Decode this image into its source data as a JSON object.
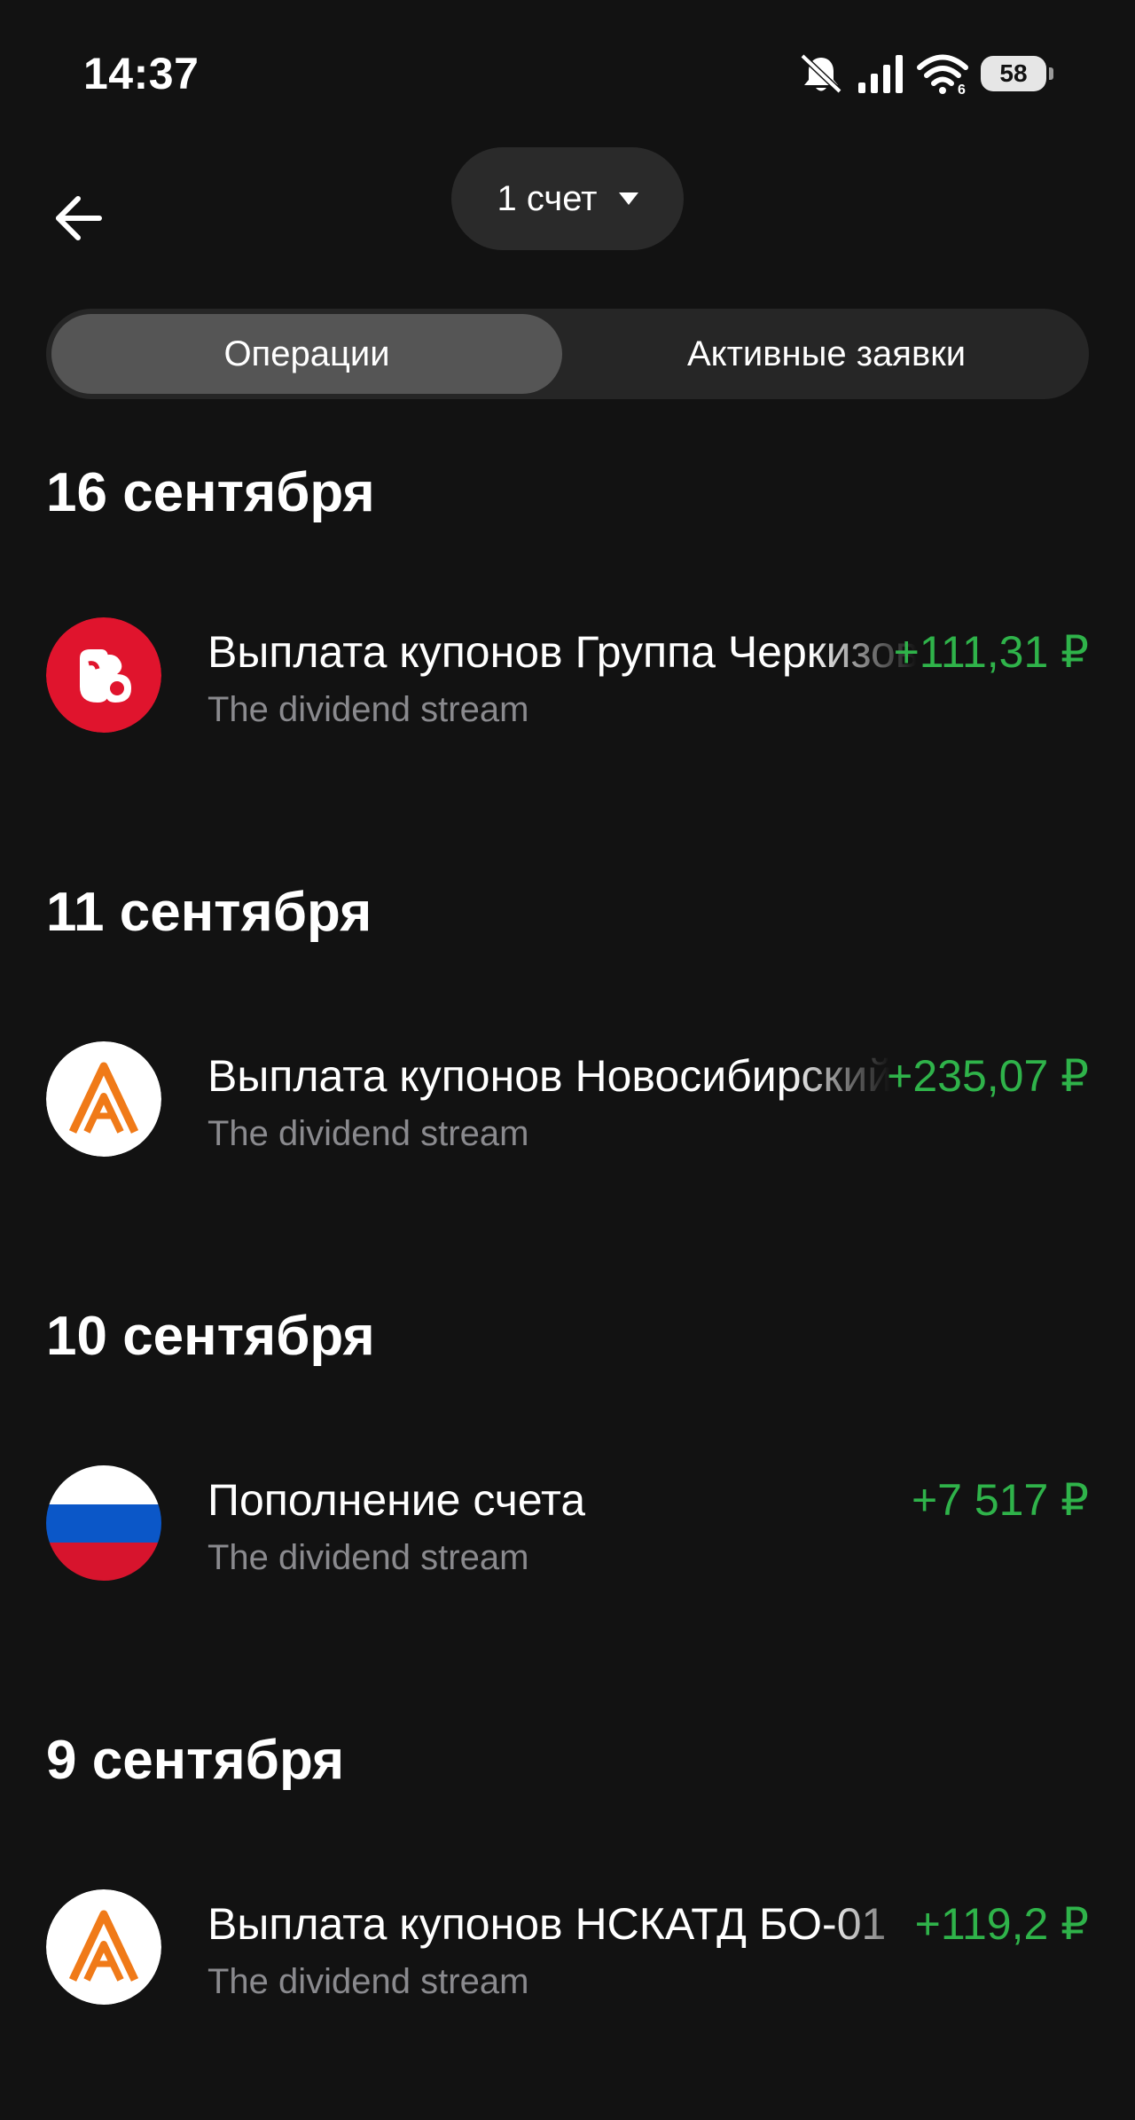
{
  "status_bar": {
    "time": "14:37",
    "battery": "58",
    "icons": [
      "mute-icon",
      "signal-icon",
      "wifi-icon",
      "battery-icon"
    ]
  },
  "header": {
    "back_icon": "arrow-left-icon",
    "account_selector": "1 счет"
  },
  "tabs": {
    "active": "Операции",
    "inactive": "Активные заявки"
  },
  "colors": {
    "background": "#121212",
    "positive_amount": "#2fb34a",
    "secondary_text": "#8a8a8e"
  },
  "days": [
    {
      "date": "16 сентября",
      "operations": [
        {
          "title": "Выплата купонов Группа Черкизово",
          "subtitle": "The dividend stream",
          "amount": "+111,31 ₽",
          "logo": "cherkizovo-logo"
        }
      ]
    },
    {
      "date": "11 сентября",
      "operations": [
        {
          "title": "Выплата купонов Новосибирский АТД",
          "subtitle": "The dividend stream",
          "amount": "+235,07 ₽",
          "logo": "nskatd-logo"
        }
      ]
    },
    {
      "date": "10 сентября",
      "operations": [
        {
          "title": "Пополнение счета",
          "subtitle": "The dividend stream",
          "amount": "+7 517 ₽",
          "logo": "russia-flag-icon"
        }
      ]
    },
    {
      "date": "9 сентября",
      "operations": [
        {
          "title": "Выплата купонов НСКАТД БО-01",
          "subtitle": "The dividend stream",
          "amount": "+119,2 ₽",
          "logo": "nskatd-logo"
        }
      ]
    }
  ]
}
